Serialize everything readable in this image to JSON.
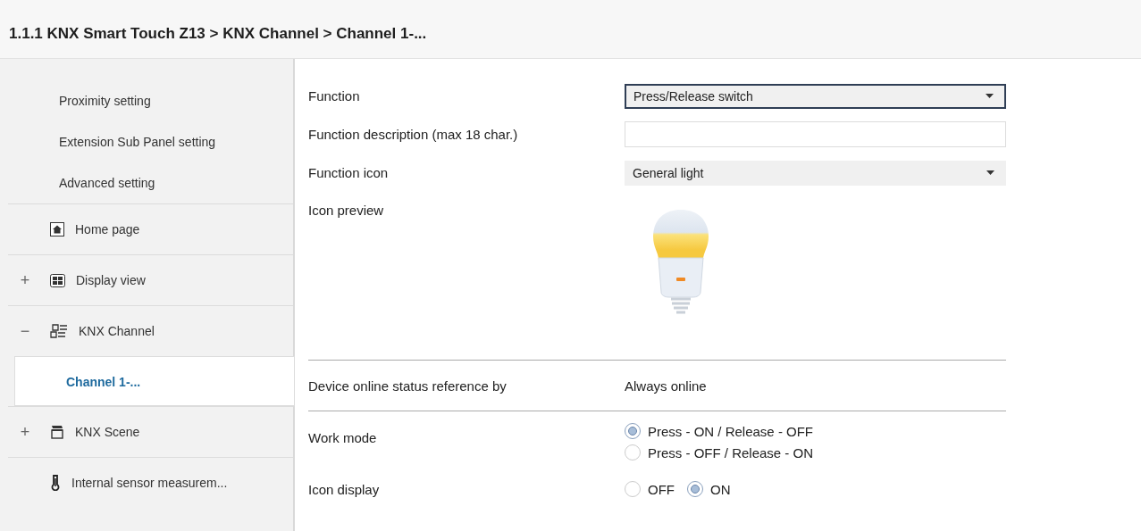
{
  "header": {
    "title": "1.1.1 KNX Smart Touch Z13 > KNX Channel  > Channel 1-..."
  },
  "sidebar": {
    "items": [
      {
        "kind": "setting",
        "label": "Proximity setting",
        "selected": false
      },
      {
        "kind": "setting",
        "label": "Extension Sub Panel setting",
        "selected": false
      },
      {
        "kind": "setting",
        "label": "Advanced setting",
        "selected": false
      },
      {
        "kind": "home",
        "label": "Home page",
        "selected": false
      },
      {
        "kind": "view",
        "toggle": "+",
        "label": "Display view",
        "selected": false
      },
      {
        "kind": "channel",
        "toggle": "−",
        "label": "KNX Channel",
        "selected": false
      },
      {
        "kind": "child",
        "label": "Channel 1-...",
        "selected": true
      },
      {
        "kind": "scene",
        "toggle": "+",
        "label": "KNX Scene",
        "selected": false
      },
      {
        "kind": "sensor",
        "label": "Internal sensor measurem...",
        "selected": false
      }
    ]
  },
  "form": {
    "rows": [
      {
        "kind": "dropdown",
        "label": "Function",
        "value": "Press/Release switch",
        "focused": true
      },
      {
        "kind": "text",
        "label": "Function description (max 18 char.)"
      },
      {
        "kind": "dropdown",
        "label": "Function icon",
        "value": "General light",
        "focused": false
      },
      {
        "kind": "preview",
        "label": "Icon preview"
      },
      {
        "kind": "info",
        "label": "Device online status reference by",
        "value": "Always online"
      },
      {
        "kind": "radio_stack",
        "label": "Work mode",
        "options": [
          {
            "label": "Press - ON / Release - OFF",
            "selected": true
          },
          {
            "label": "Press - OFF / Release - ON",
            "selected": false
          }
        ]
      },
      {
        "kind": "radio_inline",
        "label": "Icon display",
        "options": [
          {
            "label": "OFF",
            "selected": false
          },
          {
            "label": "ON",
            "selected": true
          }
        ]
      }
    ]
  }
}
